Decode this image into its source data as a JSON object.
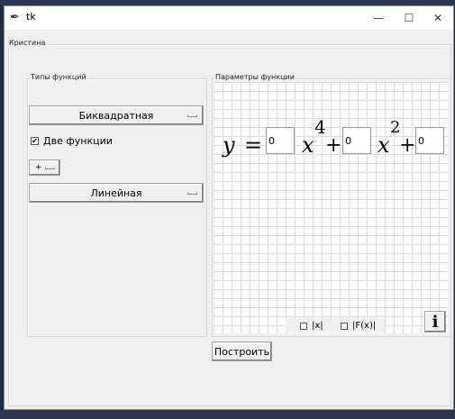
{
  "window": {
    "title": "tk",
    "minimize_symbol": "—",
    "maximize_symbol": "☐",
    "close_symbol": "✕"
  },
  "main_frame": {
    "label": "Кристина"
  },
  "types_panel": {
    "label": "Типы функций",
    "function1": "Биквадратная",
    "two_functions_checked": true,
    "two_functions_label": "Две функции",
    "operator": "+",
    "function2": "Линейная"
  },
  "params_panel": {
    "label": "Параметры функции",
    "y_symbol": "y",
    "equals": "=",
    "coef1": "0",
    "x1": "x",
    "exp1": "4",
    "plus1": "+",
    "coef2": "0",
    "x2": "x",
    "exp2": "2",
    "plus2": "+",
    "coef3": "0",
    "abs_x_label": "|x|",
    "abs_x_checked": false,
    "abs_f_label": "|F(x)|",
    "abs_f_checked": false,
    "info_symbol": "ℹ"
  },
  "build_button": {
    "label": "Построить"
  }
}
